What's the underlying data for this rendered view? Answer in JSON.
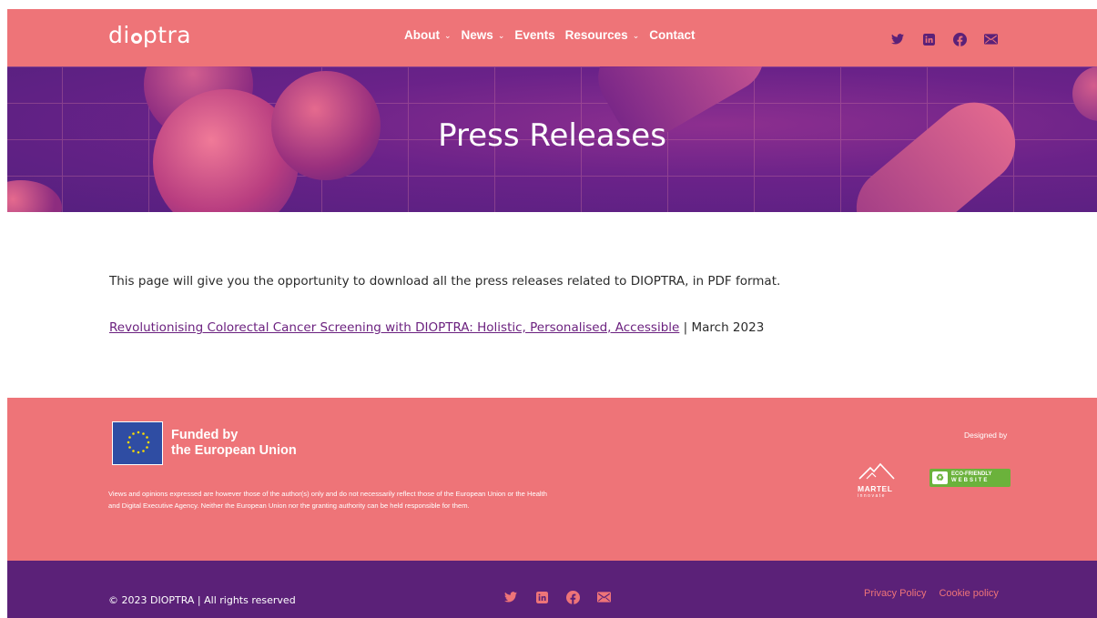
{
  "header": {
    "logo": {
      "before": "di",
      "after": "ptra"
    },
    "nav": [
      {
        "label": "About",
        "dropdown": true
      },
      {
        "label": "News",
        "dropdown": true
      },
      {
        "label": "Events",
        "dropdown": false
      },
      {
        "label": "Resources",
        "dropdown": true
      },
      {
        "label": "Contact",
        "dropdown": false
      }
    ],
    "social": [
      "twitter-icon",
      "linkedin-icon",
      "facebook-icon",
      "email-icon"
    ]
  },
  "hero": {
    "title": "Press Releases"
  },
  "content": {
    "intro": "This page will give you the opportunity to download all the press releases related to DIOPTRA, in PDF format.",
    "release_link": "Revolutionising Colorectal Cancer Screening with DIOPTRA: Holistic, Personalised, Accessible",
    "release_date": " | March 2023"
  },
  "footer": {
    "eu_line1": "Funded by",
    "eu_line2": "the European Union",
    "disclaimer": "Views and opinions expressed are however those of the author(s) only and do not necessarily reflect those of the European Union or the Health and Digital Executive Agency. Neither the European Union nor the granting authority can be held responsible for them.",
    "designed_by": "Designed by",
    "martel_label": "MARTEL",
    "martel_sub": "innovate",
    "eco_line1": "ECO-FRIENDLY",
    "eco_line2": "WEBSITE"
  },
  "bottom": {
    "copyright": "© 2023 DIOPTRA | All rights reserved",
    "privacy": "Privacy Policy",
    "cookie": "Cookie policy"
  },
  "colors": {
    "pink": "#ee7478",
    "purple": "#5b2178",
    "link": "#6a1f7e"
  }
}
